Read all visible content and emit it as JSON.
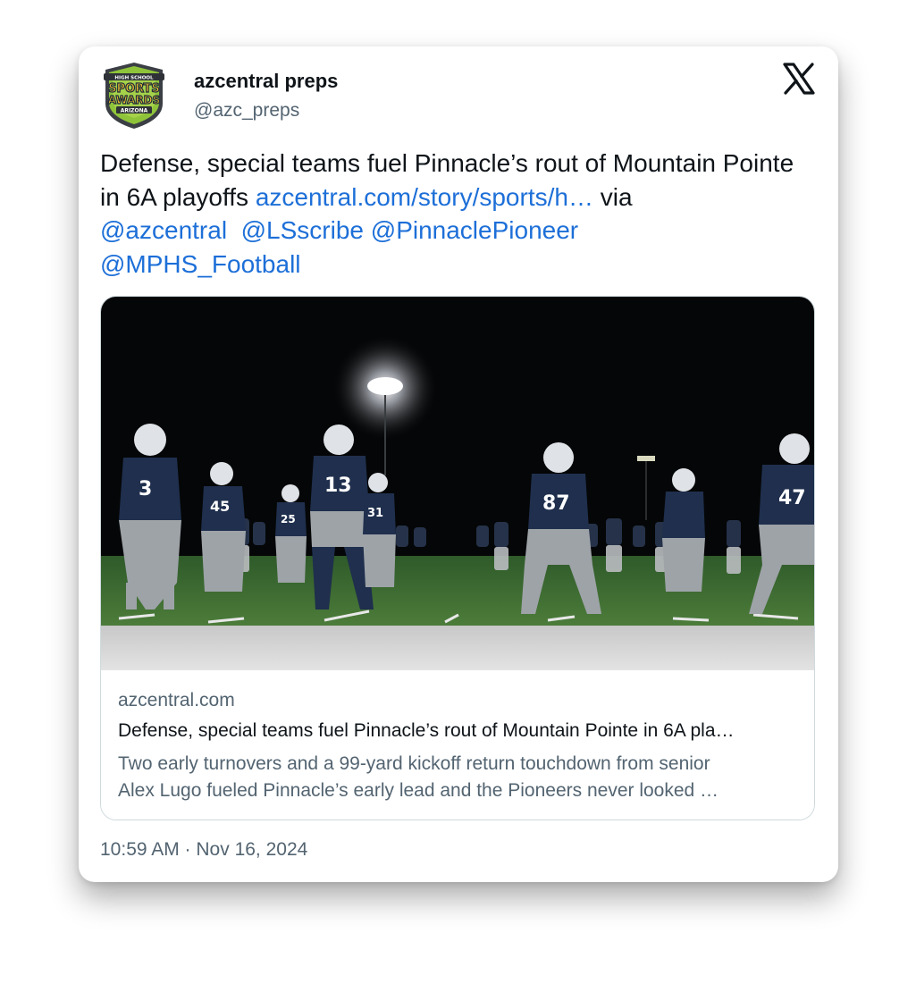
{
  "colors": {
    "link": "#1d6fd8",
    "text": "#0f1419",
    "secondary": "#536471",
    "border": "#cfd9de"
  },
  "author": {
    "name": "azcentral preps",
    "handle": "@azc_preps",
    "avatar_icon": "sports-awards-shield-logo",
    "avatar_text": {
      "top": "HIGH SCHOOL",
      "line1": "SPORTS",
      "line2": "AWARDS",
      "bottom": "ARIZONA"
    }
  },
  "platform_icon": "x-logo-icon",
  "tweet": {
    "text_start": "Defense, special teams fuel Pinnacle’s rout of Mountain Pointe in 6A playoffs ",
    "link": "azcentral.com/story/sports/h…",
    "via": " via",
    "mentions": [
      "@azcentral",
      "@LSscribe",
      "@PinnaclePioneer",
      "@MPHS_Football"
    ]
  },
  "card": {
    "domain": "azcentral.com",
    "title": "Defense, special teams fuel Pinnacle’s rout of Mountain Pointe in 6A pla…",
    "description_line1": "Two early turnovers and a 99-yard kickoff return touchdown from senior",
    "description_line2": "Alex Lugo fueled Pinnacle’s early lead and the Pioneers never looked …",
    "jersey_numbers": [
      "3",
      "45",
      "13",
      "25",
      "31",
      "87",
      "47"
    ]
  },
  "timestamp": "10:59 AM · Nov 16, 2024"
}
